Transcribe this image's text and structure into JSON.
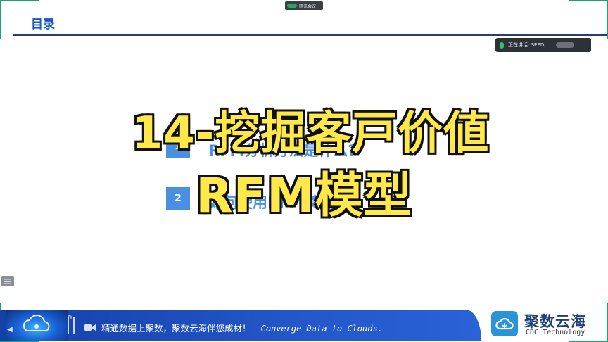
{
  "meeting": {
    "app_name": "腾讯会议"
  },
  "slide": {
    "title": "目录"
  },
  "speaking": {
    "label": "正在讲话: SEED;"
  },
  "agenda": {
    "items": [
      {
        "num": "1",
        "text": "RFM分析方法是什么?"
      },
      {
        "num": "2",
        "text": "如何使用RFM模型"
      }
    ]
  },
  "overlay": {
    "line1": "14-挖掘客戸价値",
    "line2": "RFM模型"
  },
  "banner": {
    "text_cn": "精通数据上聚数，聚数云海伴您成材！",
    "text_en": "Converge Data to Clouds."
  },
  "brand": {
    "name": "聚数云海",
    "subtitle": "CDC Technology"
  },
  "colors": {
    "accent_green": "#17a673",
    "title_blue": "#1a56c4",
    "overlay_yellow": "#ffe94a",
    "banner_blue": "#2356c9",
    "brand_icon": "#2b93d8"
  },
  "icons": [
    "mic-icon",
    "list-icon",
    "cloud-icon",
    "pen-icon",
    "camera-icon",
    "prev-icon",
    "next-icon"
  ]
}
